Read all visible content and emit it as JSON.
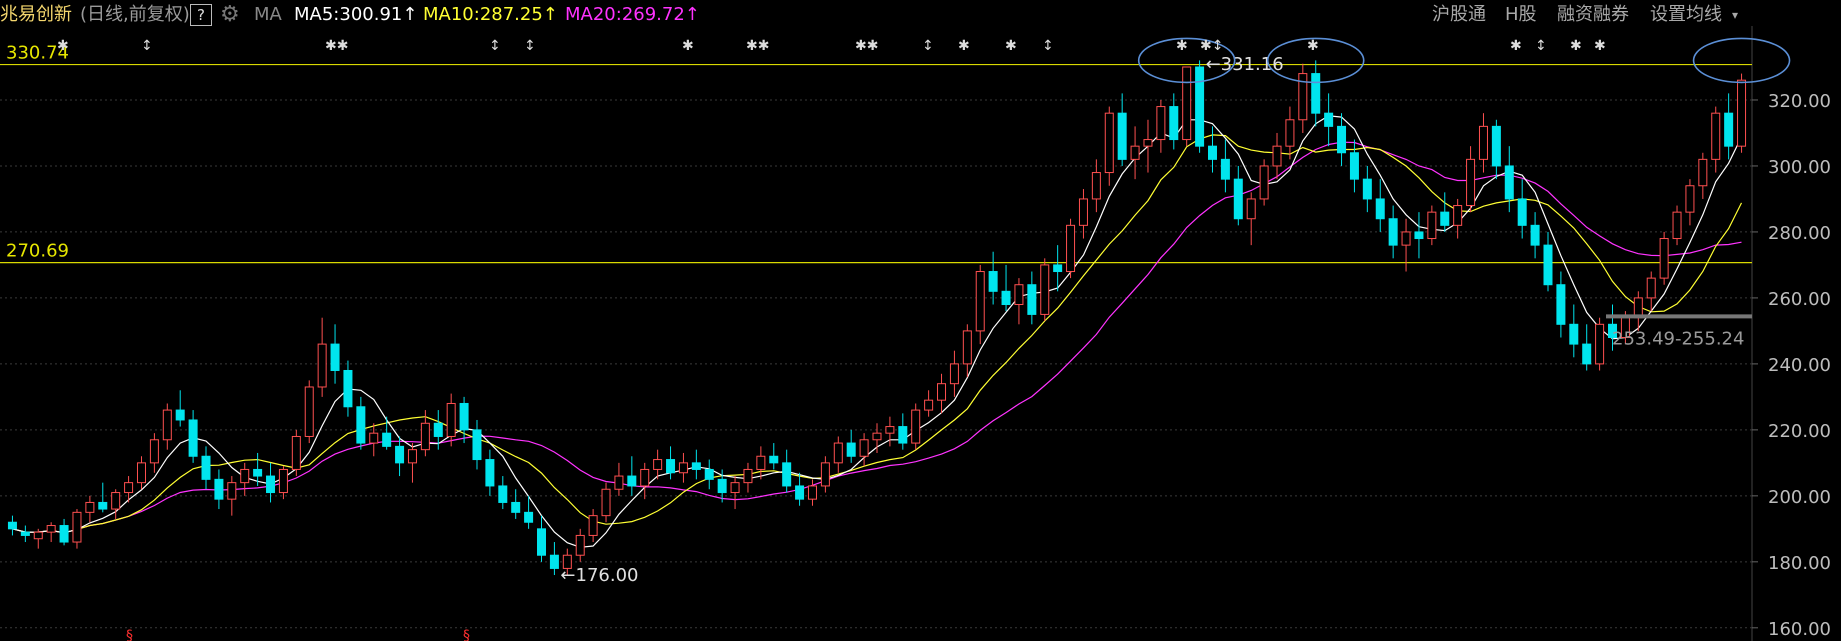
{
  "header": {
    "stock_name": "兆易创新",
    "adjust_mode": "(日线,前复权)",
    "help_label": "?",
    "ma_label": "MA",
    "ma5_text": "MA5:300.91↑",
    "ma10_text": "MA10:287.25↑",
    "ma20_text": "MA20:269.72↑",
    "links": [
      "沪股通",
      "H股",
      "融资融券",
      "设置均线"
    ],
    "colors": {
      "ma5": "#ffffff",
      "ma10": "#ffff33",
      "ma20": "#ff33ff",
      "up": "#ff5050",
      "down": "#00e5ee"
    }
  },
  "chart_data": {
    "type": "candlestick",
    "y_axis_ticks": [
      "320.00",
      "300.00",
      "280.00",
      "260.00",
      "240.00",
      "220.00",
      "200.00",
      "180.00",
      "160.00"
    ],
    "ylim": [
      156,
      340
    ],
    "levels": [
      {
        "label": "330.74",
        "value": 330.74
      },
      {
        "label": "270.69",
        "value": 270.69
      }
    ],
    "annotations": [
      {
        "text": "←331.16",
        "value": 331.16
      },
      {
        "text": "←176.00",
        "value": 176.0
      },
      {
        "text": "253.49-255.24",
        "value": 254.4
      }
    ],
    "candles": [
      [
        192,
        194,
        188,
        190
      ],
      [
        189,
        191,
        186,
        188
      ],
      [
        187,
        190,
        184,
        189
      ],
      [
        189,
        192,
        186,
        191
      ],
      [
        191,
        193,
        185,
        186
      ],
      [
        186,
        196,
        184,
        195
      ],
      [
        195,
        200,
        192,
        198
      ],
      [
        198,
        204,
        195,
        196
      ],
      [
        196,
        202,
        193,
        201
      ],
      [
        201,
        206,
        198,
        204
      ],
      [
        204,
        212,
        202,
        210
      ],
      [
        210,
        219,
        207,
        217
      ],
      [
        217,
        228,
        214,
        226
      ],
      [
        226,
        232,
        221,
        223
      ],
      [
        223,
        226,
        210,
        212
      ],
      [
        212,
        215,
        202,
        205
      ],
      [
        205,
        208,
        196,
        199
      ],
      [
        199,
        206,
        194,
        204
      ],
      [
        204,
        210,
        200,
        208
      ],
      [
        208,
        213,
        203,
        206
      ],
      [
        206,
        210,
        198,
        201
      ],
      [
        201,
        209,
        199,
        208
      ],
      [
        208,
        220,
        206,
        218
      ],
      [
        218,
        235,
        216,
        233
      ],
      [
        233,
        254,
        230,
        246
      ],
      [
        246,
        252,
        234,
        238
      ],
      [
        238,
        241,
        224,
        227
      ],
      [
        227,
        230,
        214,
        216
      ],
      [
        216,
        222,
        212,
        219
      ],
      [
        219,
        224,
        214,
        215
      ],
      [
        215,
        218,
        206,
        210
      ],
      [
        210,
        216,
        204,
        214
      ],
      [
        214,
        226,
        212,
        222
      ],
      [
        222,
        226,
        214,
        218
      ],
      [
        218,
        231,
        215,
        228
      ],
      [
        228,
        230,
        216,
        220
      ],
      [
        220,
        223,
        208,
        211
      ],
      [
        211,
        214,
        200,
        203
      ],
      [
        203,
        206,
        196,
        198
      ],
      [
        198,
        202,
        193,
        195
      ],
      [
        195,
        200,
        190,
        192
      ],
      [
        190,
        194,
        180,
        182
      ],
      [
        182,
        186,
        176,
        178
      ],
      [
        178,
        184,
        176,
        182
      ],
      [
        182,
        190,
        180,
        188
      ],
      [
        188,
        196,
        186,
        194
      ],
      [
        194,
        204,
        192,
        202
      ],
      [
        202,
        210,
        200,
        206
      ],
      [
        206,
        212,
        200,
        203
      ],
      [
        203,
        210,
        199,
        208
      ],
      [
        208,
        214,
        205,
        211
      ],
      [
        211,
        215,
        205,
        207
      ],
      [
        207,
        213,
        204,
        210
      ],
      [
        210,
        214,
        205,
        208
      ],
      [
        208,
        211,
        202,
        205
      ],
      [
        205,
        208,
        198,
        201
      ],
      [
        201,
        206,
        196,
        204
      ],
      [
        204,
        210,
        201,
        208
      ],
      [
        208,
        215,
        205,
        212
      ],
      [
        212,
        216,
        208,
        210
      ],
      [
        210,
        214,
        201,
        203
      ],
      [
        203,
        207,
        197,
        199
      ],
      [
        199,
        205,
        197,
        203
      ],
      [
        203,
        212,
        201,
        210
      ],
      [
        210,
        218,
        207,
        216
      ],
      [
        216,
        220,
        210,
        212
      ],
      [
        212,
        219,
        209,
        217
      ],
      [
        217,
        222,
        213,
        219
      ],
      [
        219,
        224,
        215,
        221
      ],
      [
        221,
        225,
        214,
        216
      ],
      [
        216,
        228,
        214,
        226
      ],
      [
        226,
        232,
        224,
        229
      ],
      [
        229,
        237,
        225,
        234
      ],
      [
        234,
        244,
        230,
        240
      ],
      [
        240,
        252,
        236,
        250
      ],
      [
        250,
        270,
        246,
        268
      ],
      [
        268,
        274,
        258,
        262
      ],
      [
        262,
        270,
        256,
        258
      ],
      [
        258,
        266,
        252,
        264
      ],
      [
        264,
        268,
        252,
        255
      ],
      [
        255,
        272,
        253,
        270
      ],
      [
        270,
        276,
        262,
        268
      ],
      [
        268,
        284,
        266,
        282
      ],
      [
        282,
        293,
        278,
        290
      ],
      [
        290,
        302,
        286,
        298
      ],
      [
        298,
        318,
        294,
        316
      ],
      [
        316,
        322,
        300,
        302
      ],
      [
        302,
        312,
        296,
        306
      ],
      [
        306,
        314,
        298,
        308
      ],
      [
        308,
        320,
        304,
        318
      ],
      [
        318,
        322,
        305,
        308
      ],
      [
        308,
        330,
        306,
        330
      ],
      [
        330,
        332,
        304,
        306
      ],
      [
        306,
        312,
        298,
        302
      ],
      [
        302,
        308,
        292,
        296
      ],
      [
        296,
        300,
        282,
        284
      ],
      [
        284,
        292,
        276,
        290
      ],
      [
        290,
        302,
        288,
        300
      ],
      [
        300,
        310,
        296,
        306
      ],
      [
        306,
        318,
        302,
        314
      ],
      [
        314,
        331,
        310,
        328
      ],
      [
        328,
        332,
        312,
        316
      ],
      [
        316,
        322,
        306,
        312
      ],
      [
        312,
        316,
        300,
        304
      ],
      [
        304,
        308,
        292,
        296
      ],
      [
        296,
        300,
        286,
        290
      ],
      [
        290,
        296,
        280,
        284
      ],
      [
        284,
        288,
        272,
        276
      ],
      [
        276,
        284,
        268,
        280
      ],
      [
        280,
        286,
        272,
        278
      ],
      [
        278,
        288,
        276,
        286
      ],
      [
        286,
        292,
        280,
        282
      ],
      [
        282,
        290,
        278,
        288
      ],
      [
        288,
        306,
        286,
        302
      ],
      [
        302,
        316,
        298,
        312
      ],
      [
        312,
        314,
        296,
        300
      ],
      [
        300,
        306,
        286,
        290
      ],
      [
        290,
        296,
        278,
        282
      ],
      [
        282,
        286,
        272,
        276
      ],
      [
        276,
        280,
        262,
        264
      ],
      [
        264,
        268,
        248,
        252
      ],
      [
        252,
        258,
        242,
        246
      ],
      [
        246,
        252,
        238,
        240
      ],
      [
        240,
        254,
        238,
        252
      ],
      [
        252,
        258,
        244,
        248
      ],
      [
        248,
        256,
        246,
        254
      ],
      [
        254,
        262,
        250,
        260
      ],
      [
        260,
        268,
        256,
        266
      ],
      [
        266,
        280,
        264,
        278
      ],
      [
        278,
        288,
        276,
        286
      ],
      [
        286,
        296,
        282,
        294
      ],
      [
        294,
        304,
        290,
        302
      ],
      [
        302,
        318,
        298,
        316
      ],
      [
        316,
        322,
        302,
        306
      ],
      [
        306,
        328,
        304,
        326
      ]
    ]
  }
}
